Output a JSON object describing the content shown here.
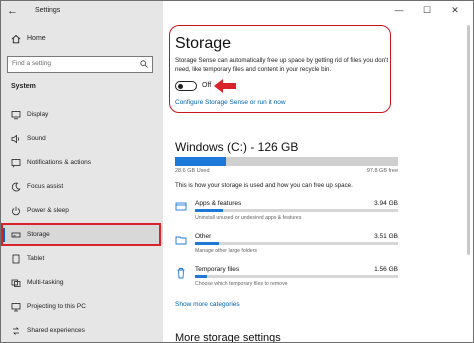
{
  "window": {
    "title": "Settings",
    "controls": {
      "minimize": "—",
      "maximize": "☐",
      "close": "✕"
    }
  },
  "sidebar": {
    "home_label": "Home",
    "search_placeholder": "Find a setting",
    "section_label": "System",
    "items": [
      {
        "label": "Display",
        "icon": "display-icon"
      },
      {
        "label": "Sound",
        "icon": "speaker-icon"
      },
      {
        "label": "Notifications & actions",
        "icon": "notification-icon"
      },
      {
        "label": "Focus assist",
        "icon": "moon-icon"
      },
      {
        "label": "Power & sleep",
        "icon": "power-icon"
      },
      {
        "label": "Storage",
        "icon": "drive-icon",
        "active": true
      },
      {
        "label": "Tablet",
        "icon": "tablet-icon"
      },
      {
        "label": "Multi-tasking",
        "icon": "multitasking-icon"
      },
      {
        "label": "Projecting to this PC",
        "icon": "projector-icon"
      },
      {
        "label": "Shared experiences",
        "icon": "shared-icon"
      }
    ]
  },
  "main": {
    "title": "Storage",
    "description": "Storage Sense can automatically free up space by getting rid of files you don't need, like temporary files and content in your recycle bin.",
    "toggle_state": "Off",
    "configure_link": "Configure Storage Sense or run it now",
    "drive_title": "Windows (C:) - 126 GB",
    "used": "28.6 GB Used",
    "free": "97.8 GB free",
    "used_fraction": 0.227,
    "info": "This is how your storage is used and how you can free up space.",
    "categories": [
      {
        "name": "Apps & features",
        "size": "3.94 GB",
        "sub": "Uninstall unused or undesired apps & features",
        "fraction": 0.14,
        "icon": "apps-icon"
      },
      {
        "name": "Other",
        "size": "3.51 GB",
        "sub": "Manage other large folders",
        "fraction": 0.12,
        "icon": "folder-icon"
      },
      {
        "name": "Temporary files",
        "size": "1.56 GB",
        "sub": "Choose which temporary files to remove",
        "fraction": 0.06,
        "icon": "trash-icon"
      }
    ],
    "show_more": "Show more categories",
    "more_title": "More storage settings"
  },
  "colors": {
    "accent": "#0067c0",
    "highlight": "#d8232a",
    "bar": "#1e78d7"
  }
}
